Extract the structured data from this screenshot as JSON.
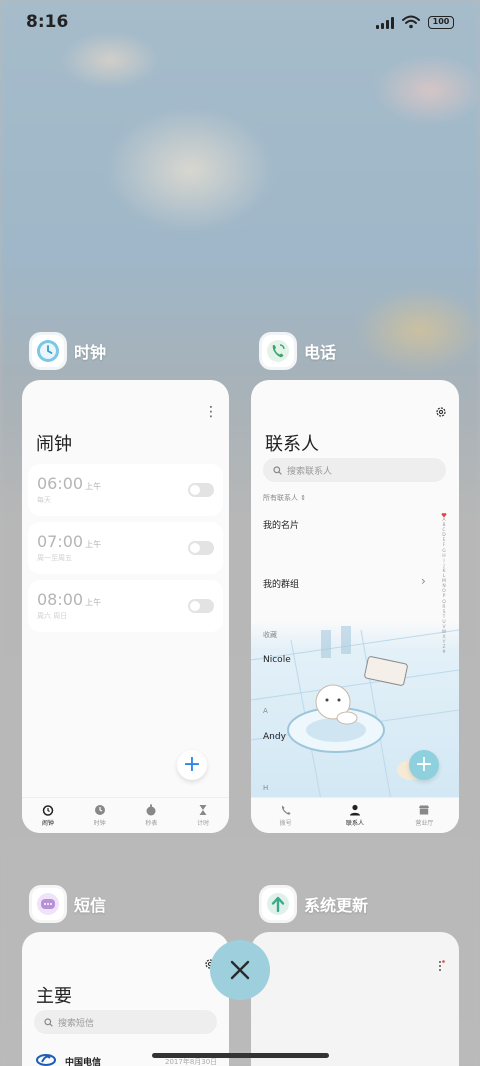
{
  "status_bar": {
    "time": "8:16",
    "battery": "100"
  },
  "apps": {
    "clock": {
      "title": "时钟",
      "header": "闹钟",
      "more": "⋮",
      "alarms": [
        {
          "time": "06:00",
          "ampm": "上午",
          "repeat": "每天",
          "enabled": false
        },
        {
          "time": "07:00",
          "ampm": "上午",
          "repeat": "周一至周五",
          "enabled": false
        },
        {
          "time": "08:00",
          "ampm": "上午",
          "repeat": "周六 周日",
          "enabled": false
        }
      ],
      "add": "+",
      "tabs": [
        "闹钟",
        "时钟",
        "秒表",
        "计时"
      ],
      "active_tab": "闹钟"
    },
    "phone": {
      "title": "电话",
      "header": "联系人",
      "search_placeholder": "搜索联系人",
      "filter": "所有联系人 ⇕",
      "my_card": "我的名片",
      "my_groups": "我的群组",
      "section_favorites": "收藏",
      "contact_1": "Nicole",
      "section_a": "A",
      "contact_2": "Andy",
      "section_h": "H",
      "add": "+",
      "alphabet": [
        "A",
        "B",
        "C",
        "D",
        "E",
        "F",
        "G",
        "H",
        "I",
        "J",
        "K",
        "L",
        "M",
        "N",
        "O",
        "P",
        "Q",
        "R",
        "S",
        "T",
        "U",
        "V",
        "W",
        "X",
        "Y",
        "Z",
        "#"
      ],
      "tabs": [
        "拨号",
        "联系人",
        "营业厅"
      ],
      "active_tab": "联系人"
    },
    "messages": {
      "title": "短信",
      "header": "主要",
      "search_placeholder": "搜索短信",
      "first_sender": "中国电信",
      "first_date": "2017年8月30日"
    },
    "updater": {
      "title": "系统更新"
    }
  },
  "colors": {
    "accent_blue": "#2f86e8",
    "close_button": "#9ecfdc",
    "heart_red": "#e04848"
  }
}
